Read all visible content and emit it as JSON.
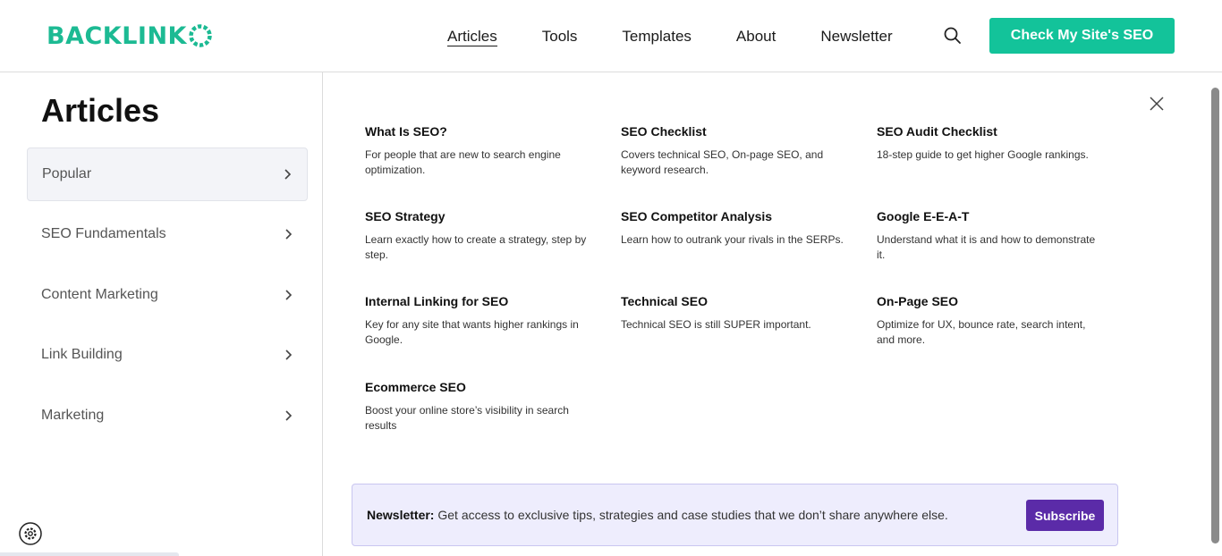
{
  "header": {
    "logo": "BACKLINK",
    "nav": [
      "Articles",
      "Tools",
      "Templates",
      "About",
      "Newsletter"
    ],
    "active_nav": "Articles",
    "search_icon": "search-icon",
    "cta_label": "Check My Site's SEO",
    "brand_color": "#13c39a"
  },
  "sidebar": {
    "title": "Articles",
    "categories": [
      {
        "label": "Popular",
        "active": true
      },
      {
        "label": "SEO Fundamentals",
        "active": false
      },
      {
        "label": "Content Marketing",
        "active": false
      },
      {
        "label": "Link Building",
        "active": false
      },
      {
        "label": "Marketing",
        "active": false
      }
    ],
    "settings_icon": "gear-icon"
  },
  "articles": [
    {
      "title": "What Is SEO?",
      "desc": "For people that are new to search engine optimization."
    },
    {
      "title": "SEO Checklist",
      "desc": "Covers technical SEO, On-page SEO, and keyword research."
    },
    {
      "title": "SEO Audit Checklist",
      "desc": "18-step guide to get higher Google rankings."
    },
    {
      "title": "SEO Strategy",
      "desc": "Learn exactly how to create a strategy, step by step."
    },
    {
      "title": "SEO Competitor Analysis",
      "desc": "Learn how to outrank your rivals in the SERPs."
    },
    {
      "title": "Google E-E-A-T",
      "desc": "Understand what it is and how to demonstrate it."
    },
    {
      "title": "Internal Linking for SEO",
      "desc": "Key for any site that wants higher rankings in Google."
    },
    {
      "title": "Technical SEO",
      "desc": "Technical SEO is still SUPER important."
    },
    {
      "title": "On-Page SEO",
      "desc": "Optimize for UX, bounce rate, search intent, and more."
    },
    {
      "title": "Ecommerce SEO",
      "desc": "Boost your online store’s visibility in search results"
    }
  ],
  "newsletter": {
    "label": "Newsletter:",
    "text": " Get access to exclusive tips, strategies and case studies that we don’t share anywhere else.",
    "button": "Subscribe",
    "accent": "#5b2ba8"
  }
}
